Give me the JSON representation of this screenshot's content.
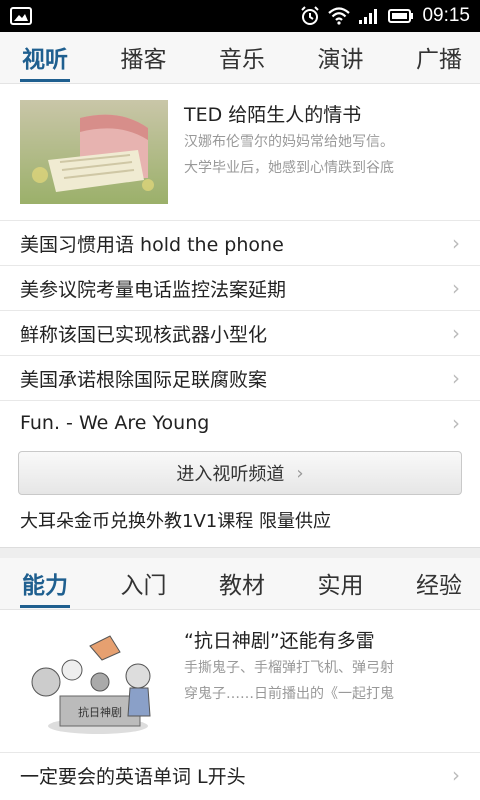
{
  "status_bar": {
    "time": "09:15"
  },
  "tabs_top": [
    {
      "label": "视听",
      "active": true
    },
    {
      "label": "播客",
      "active": false
    },
    {
      "label": "音乐",
      "active": false
    },
    {
      "label": "演讲",
      "active": false
    },
    {
      "label": "广播",
      "active": false
    }
  ],
  "feature_top": {
    "title": "TED 给陌生人的情书",
    "desc1": "汉娜布伦雪尔的妈妈常给她写信。",
    "desc2": "大学毕业后，她感到心情跌到谷底"
  },
  "list_top": [
    "美国习惯用语 hold the phone",
    "美参议院考量电话监控法案延期",
    "鲜称该国已实现核武器小型化",
    "美国承诺根除国际足联腐败案",
    "Fun. - We Are Young"
  ],
  "channel_button": "进入视听频道",
  "promo": "大耳朵金币兑换外教1V1课程 限量供应",
  "tabs_bottom": [
    {
      "label": "能力",
      "active": true
    },
    {
      "label": "入门",
      "active": false
    },
    {
      "label": "教材",
      "active": false
    },
    {
      "label": "实用",
      "active": false
    },
    {
      "label": "经验",
      "active": false
    }
  ],
  "feature_bottom": {
    "title": "“抗日神剧”还能有多雷",
    "desc1": "手撕鬼子、手榴弹打飞机、弹弓射",
    "desc2": "穿鬼子……日前播出的《一起打鬼",
    "illustration_text": "抗日神剧"
  },
  "list_bottom": [
    "一定要会的英语单词 L开头"
  ]
}
